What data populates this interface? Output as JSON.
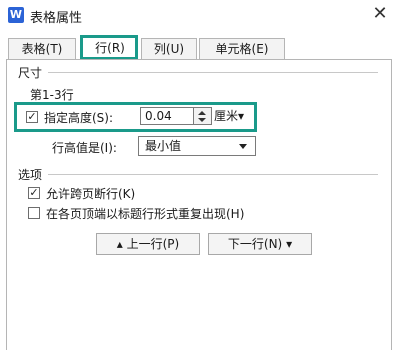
{
  "window": {
    "title": "表格属性",
    "app_icon_glyph": "W"
  },
  "tabs": [
    {
      "label": "表格(T)"
    },
    {
      "label": "行(R)"
    },
    {
      "label": "列(U)"
    },
    {
      "label": "单元格(E)"
    }
  ],
  "size": {
    "section_label": "尺寸",
    "row_range": "第1-3行",
    "specify_height_label": "指定高度(S):",
    "specify_height_checked": true,
    "height_value": "0.04",
    "unit": "厘米",
    "row_height_is_label": "行高值是(I):",
    "row_height_is_value": "最小值"
  },
  "options": {
    "section_label": "选项",
    "allow_break_label": "允许跨页断行(K)",
    "allow_break_checked": true,
    "repeat_header_label": "在各页顶端以标题行形式重复出现(H)",
    "repeat_header_checked": false
  },
  "buttons": {
    "prev_row": "上一行(P)",
    "next_row": "下一行(N)"
  },
  "colors": {
    "highlight": "#1a9a8a",
    "app_icon": "#2b63d6"
  },
  "glyphs": {
    "close": "✕",
    "check": "✓",
    "up_arrow": "▴",
    "down_arrow": "▾"
  }
}
